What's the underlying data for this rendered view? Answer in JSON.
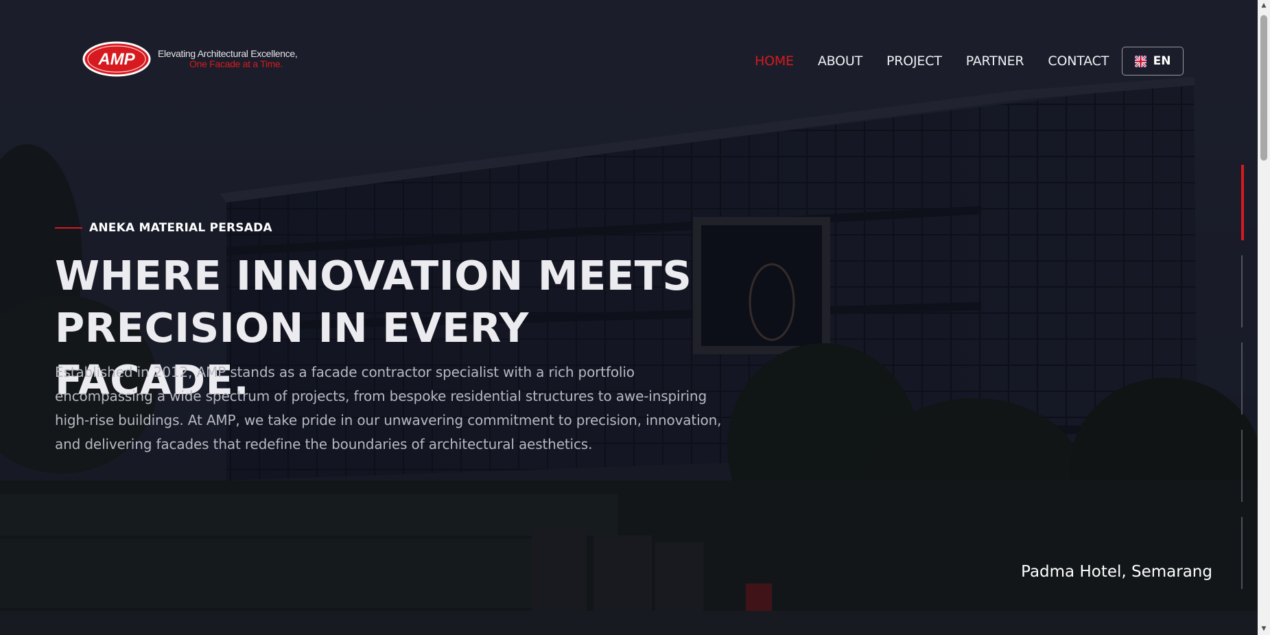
{
  "header": {
    "logo_text": "AMP",
    "tagline_line1": "Elevating Architectural Excellence,",
    "tagline_line2": "One Facade at a Time."
  },
  "nav": {
    "items": [
      {
        "label": "HOME",
        "active": true
      },
      {
        "label": "ABOUT",
        "active": false
      },
      {
        "label": "PROJECT",
        "active": false
      },
      {
        "label": "PARTNER",
        "active": false
      },
      {
        "label": "CONTACT",
        "active": false
      }
    ],
    "language": {
      "label": "EN",
      "flag_icon": "uk-flag-icon"
    }
  },
  "hero": {
    "eyebrow": "ANEKA MATERIAL PERSADA",
    "headline_line1": "WHERE INNOVATION MEETS",
    "headline_line2": "PRECISION IN EVERY FACADE.",
    "description": "Established in 2012, AMP stands as a facade contractor specialist with a rich portfolio encompassing a wide spectrum of projects, from bespoke residential structures to awe-inspiring high-rise buildings. At AMP, we take pride in our unwavering commitment to precision, innovation, and delivering facades that redefine the boundaries of architectural aesthetics.",
    "caption": "Padma Hotel, Semarang"
  },
  "slider": {
    "slide_count": 5,
    "active_index": 0
  },
  "colors": {
    "accent": "#d61a1f",
    "background": "#1c1f2a",
    "text": "#ececf0"
  }
}
